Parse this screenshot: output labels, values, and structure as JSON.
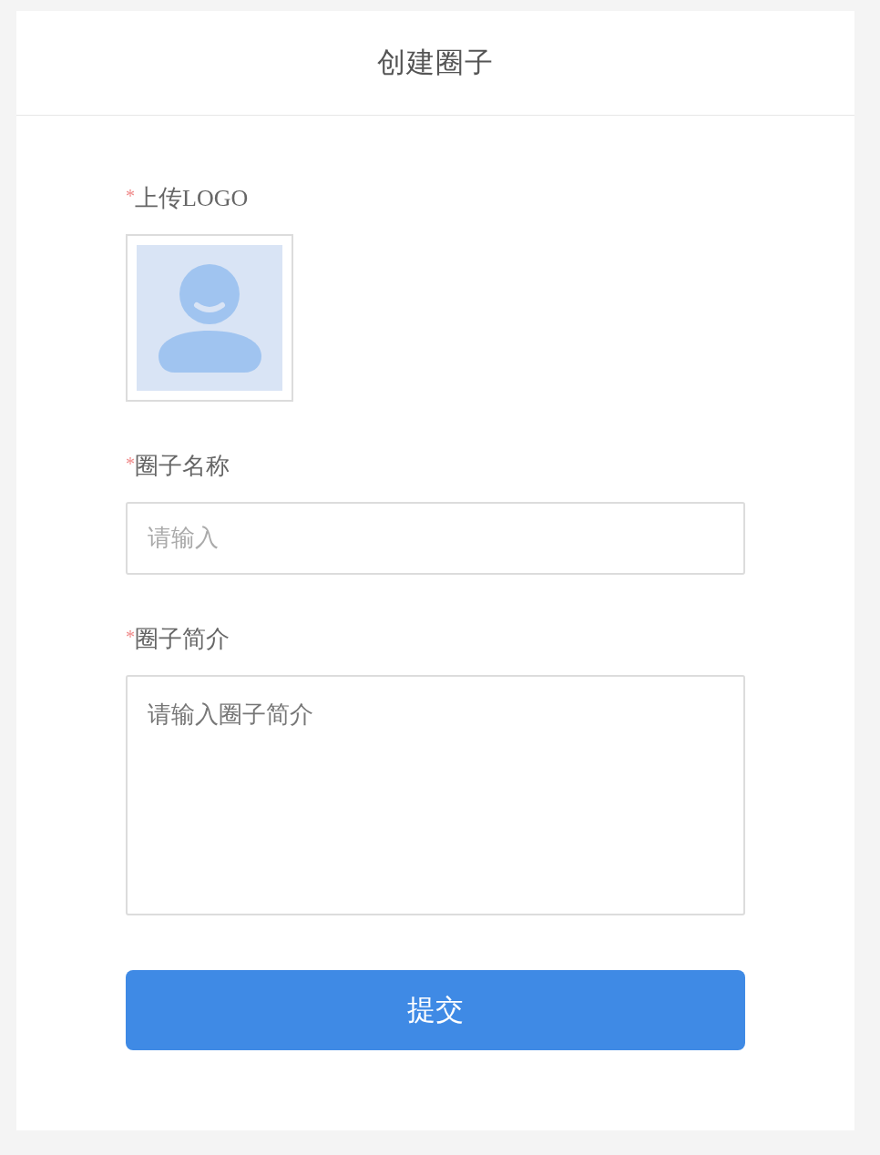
{
  "header": {
    "title": "创建圈子"
  },
  "form": {
    "fields": [
      {
        "kind": "upload",
        "required_mark": "*",
        "label": "上传LOGO"
      },
      {
        "kind": "input",
        "required_mark": "*",
        "label": "圈子名称",
        "placeholder": "请输入"
      },
      {
        "kind": "textarea",
        "required_mark": "*",
        "label": "圈子简介",
        "placeholder": "请输入圈子简介"
      }
    ]
  },
  "submit_button": {
    "label": "提交"
  }
}
